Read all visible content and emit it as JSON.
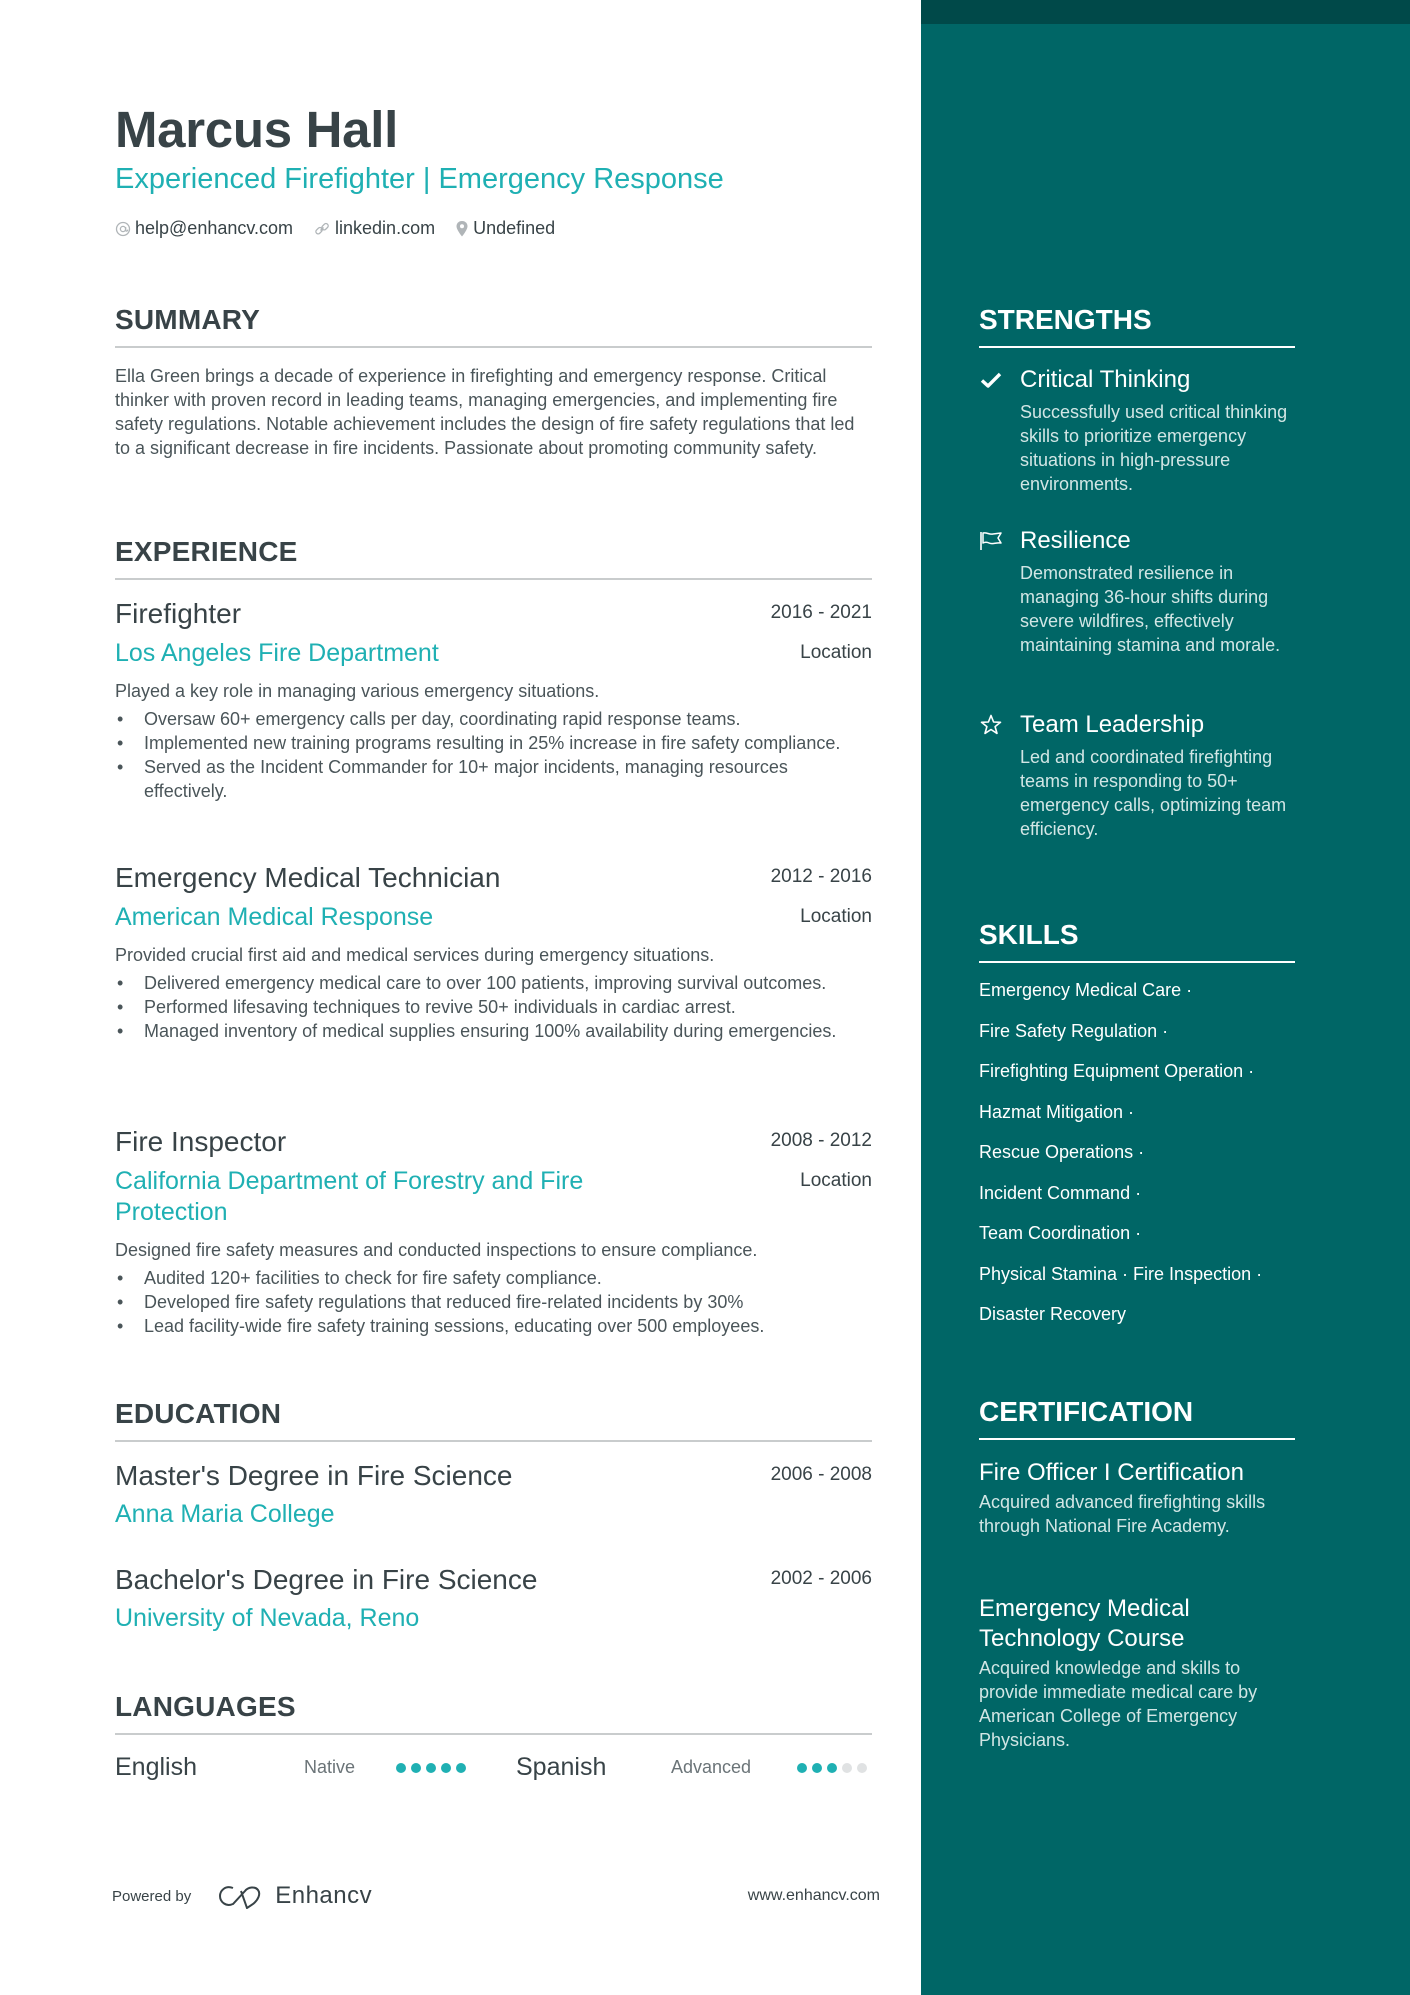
{
  "colors": {
    "accent": "#1fb0b3",
    "sidebar": "#006666",
    "sidebar_band": "#004949",
    "text": "#384347"
  },
  "header": {
    "name": "Marcus Hall",
    "title": "Experienced Firefighter | Emergency Response",
    "contacts": [
      {
        "icon": "at-icon",
        "text": "help@enhancv.com"
      },
      {
        "icon": "link-icon",
        "text": "linkedin.com"
      },
      {
        "icon": "location-pin-icon",
        "text": "Undefined"
      }
    ]
  },
  "summary": {
    "heading": "SUMMARY",
    "text": "Ella Green brings a decade of experience in firefighting and emergency response. Critical thinker with proven record in leading teams, managing emergencies, and implementing fire safety regulations. Notable achievement includes the design of fire safety regulations that led to a significant decrease in fire incidents. Passionate about promoting community safety."
  },
  "experience": {
    "heading": "EXPERIENCE",
    "jobs": [
      {
        "title": "Firefighter",
        "dates": "2016 - 2021",
        "company": "Los Angeles Fire Department",
        "location": "Location",
        "description": "Played a key role in managing various emergency situations.",
        "bullets": [
          "Oversaw 60+ emergency calls per day, coordinating rapid response teams.",
          "Implemented new training programs resulting in 25% increase in fire safety compliance.",
          "Served as the Incident Commander for 10+ major incidents, managing resources effectively."
        ]
      },
      {
        "title": "Emergency Medical Technician",
        "dates": "2012 - 2016",
        "company": "American Medical Response",
        "location": "Location",
        "description": "Provided crucial first aid and medical services during emergency situations.",
        "bullets": [
          "Delivered emergency medical care to over 100 patients, improving survival outcomes.",
          "Performed lifesaving techniques to revive 50+ individuals in cardiac arrest.",
          "Managed inventory of medical supplies ensuring 100% availability during emergencies."
        ]
      },
      {
        "title": "Fire Inspector",
        "dates": "2008 - 2012",
        "company": "California Department of Forestry and Fire Protection",
        "location": "Location",
        "description": "Designed fire safety measures and conducted inspections to ensure compliance.",
        "bullets": [
          "Audited 120+ facilities to check for fire safety compliance.",
          "Developed fire safety regulations that reduced fire-related incidents by 30%",
          "Lead facility-wide fire safety training sessions, educating over 500 employees."
        ]
      }
    ]
  },
  "education": {
    "heading": "EDUCATION",
    "items": [
      {
        "degree": "Master's Degree in Fire Science",
        "dates": "2006 - 2008",
        "school": "Anna Maria College"
      },
      {
        "degree": "Bachelor's Degree in Fire Science",
        "dates": "2002 - 2006",
        "school": "University of Nevada, Reno"
      }
    ]
  },
  "languages": {
    "heading": "LANGUAGES",
    "items": [
      {
        "name": "English",
        "level": "Native",
        "rating": 5,
        "max": 5
      },
      {
        "name": "Spanish",
        "level": "Advanced",
        "rating": 3,
        "max": 5
      }
    ]
  },
  "strengths": {
    "heading": "STRENGTHS",
    "items": [
      {
        "icon": "checkmark-icon",
        "title": "Critical Thinking",
        "description": "Successfully used critical thinking skills to prioritize emergency situations in high-pressure environments."
      },
      {
        "icon": "flag-icon",
        "title": "Resilience",
        "description": "Demonstrated resilience in managing 36-hour shifts during severe wildfires, effectively maintaining stamina and morale."
      },
      {
        "icon": "star-icon",
        "title": "Team Leadership",
        "description": "Led and coordinated firefighting teams in responding to 50+ emergency calls, optimizing team efficiency."
      }
    ]
  },
  "skills": {
    "heading": "SKILLS",
    "lines": [
      "Emergency Medical Care ·",
      "Fire Safety Regulation ·",
      "Firefighting Equipment Operation ·",
      "Hazmat Mitigation ·",
      "Rescue Operations ·",
      "Incident Command ·",
      "Team Coordination ·",
      "Physical Stamina · Fire Inspection ·",
      "Disaster Recovery"
    ]
  },
  "certification": {
    "heading": "CERTIFICATION",
    "items": [
      {
        "title": "Fire Officer I Certification",
        "description": "Acquired advanced firefighting skills through National Fire Academy."
      },
      {
        "title": "Emergency Medical Technology Course",
        "description": "Acquired knowledge and skills to provide immediate medical care by American College of Emergency Physicians."
      }
    ]
  },
  "footer": {
    "powered_by": "Powered by",
    "brand": "Enhancv",
    "url": "www.enhancv.com"
  }
}
